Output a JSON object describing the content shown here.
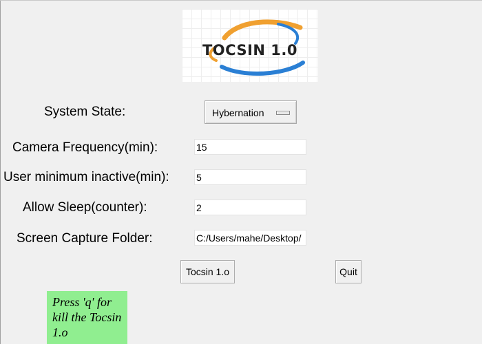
{
  "logo": {
    "text": "TOCSIN 1.0",
    "arc_colors": [
      "#f0a030",
      "#2a7fd4"
    ]
  },
  "form": {
    "system_state": {
      "label": "System State:",
      "value": "Hybernation"
    },
    "camera_frequency": {
      "label": "Camera Frequency(min):",
      "value": "15"
    },
    "user_min_inactive": {
      "label": "User minimum inactive(min):",
      "value": "5"
    },
    "allow_sleep": {
      "label": "Allow Sleep(counter):",
      "value": "2"
    },
    "capture_folder": {
      "label": "Screen Capture Folder:",
      "value": "C:/Users/mahe/Desktop/"
    }
  },
  "buttons": {
    "tocsin": "Tocsin 1.o",
    "quit": "Quit"
  },
  "hint": {
    "text": "Press 'q' for kill the Tocsin 1.o",
    "background": "#90ee90"
  }
}
